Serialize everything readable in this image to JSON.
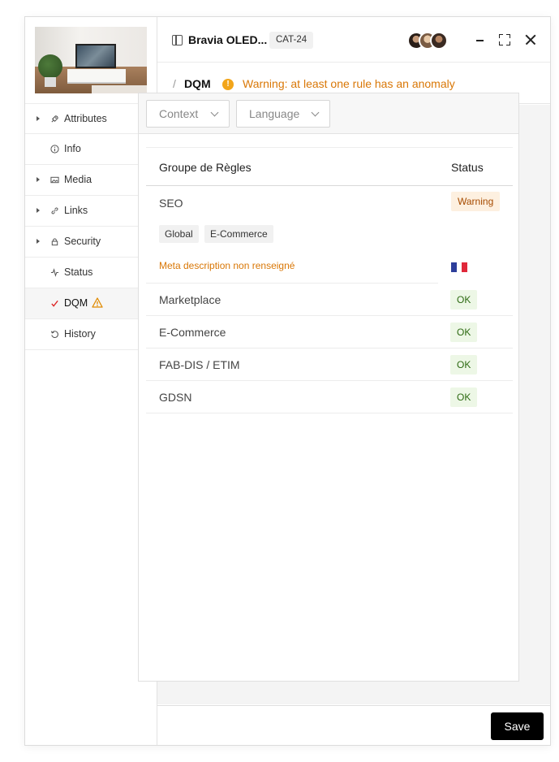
{
  "product": {
    "title": "Bravia OLED...",
    "category_badge": "CAT-24"
  },
  "sidebar": {
    "items": [
      {
        "label": "Attributes",
        "icon": "rocket-icon",
        "expandable": true
      },
      {
        "label": "Info",
        "icon": "info-icon",
        "expandable": false
      },
      {
        "label": "Media",
        "icon": "image-icon",
        "expandable": true
      },
      {
        "label": "Links",
        "icon": "link-icon",
        "expandable": true
      },
      {
        "label": "Security",
        "icon": "lock-icon",
        "expandable": true
      },
      {
        "label": "Status",
        "icon": "activity-icon",
        "expandable": false
      },
      {
        "label": "DQM",
        "icon": "check-icon",
        "expandable": false,
        "active": true,
        "warning": true
      },
      {
        "label": "History",
        "icon": "history-icon",
        "expandable": false
      }
    ]
  },
  "breadcrumb": {
    "separator": "/",
    "page": "DQM",
    "warning_icon_glyph": "!",
    "warning_message": "Warning: at least one rule has an anomaly"
  },
  "filters": {
    "context_label": "Context",
    "language_label": "Language"
  },
  "table": {
    "headers": {
      "group": "Groupe de Règles",
      "status": "Status"
    },
    "seo": {
      "name": "SEO",
      "status": "Warning",
      "tags": [
        "Global",
        "E-Commerce"
      ],
      "rule_message": "Meta description non renseigné",
      "flag_colors": [
        "#2d3e9a",
        "#ffffff",
        "#e0283a"
      ]
    },
    "rows": [
      {
        "name": "Marketplace",
        "status": "OK"
      },
      {
        "name": "E-Commerce",
        "status": "OK"
      },
      {
        "name": "FAB-DIS / ETIM",
        "status": "OK"
      },
      {
        "name": "GDSN",
        "status": "OK"
      }
    ]
  },
  "footer": {
    "save_label": "Save"
  },
  "colors": {
    "warning_text": "#d97706",
    "warning_dot": "#f2a51a",
    "ok_bg": "#edf7e6",
    "ok_text": "#2d6a12",
    "warning_badge_bg": "#fdf0e0",
    "warning_badge_text": "#a64b00",
    "save_bg": "#000000"
  }
}
